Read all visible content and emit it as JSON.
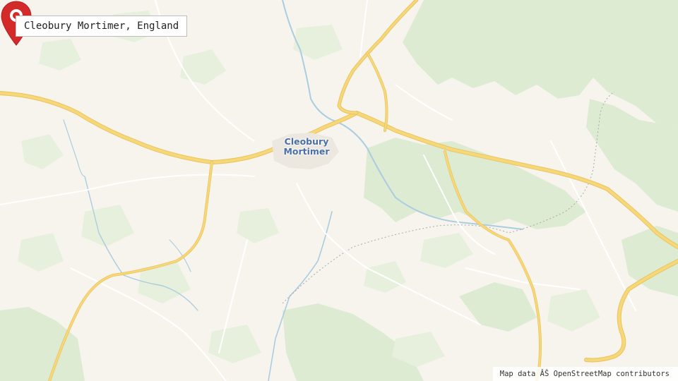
{
  "location_label": "Cleobury Mortimer, England",
  "town": {
    "line1": "Cleobury",
    "line2": "Mortimer"
  },
  "attribution": "Map data ÂŠ OpenStreetMap contributors",
  "colors": {
    "land": "#f7f4ee",
    "woodland": "#d9ead0",
    "field_green": "#e3efd9",
    "river": "#aacde0",
    "major_road": "#f6d77a",
    "major_road_casing": "#e9c45a",
    "minor_road": "#ffffff",
    "marker": "#d32a2a",
    "town_label": "#4a6fa5",
    "boundary": "#a9a9a9"
  },
  "marker_icon": "map-pin-icon"
}
